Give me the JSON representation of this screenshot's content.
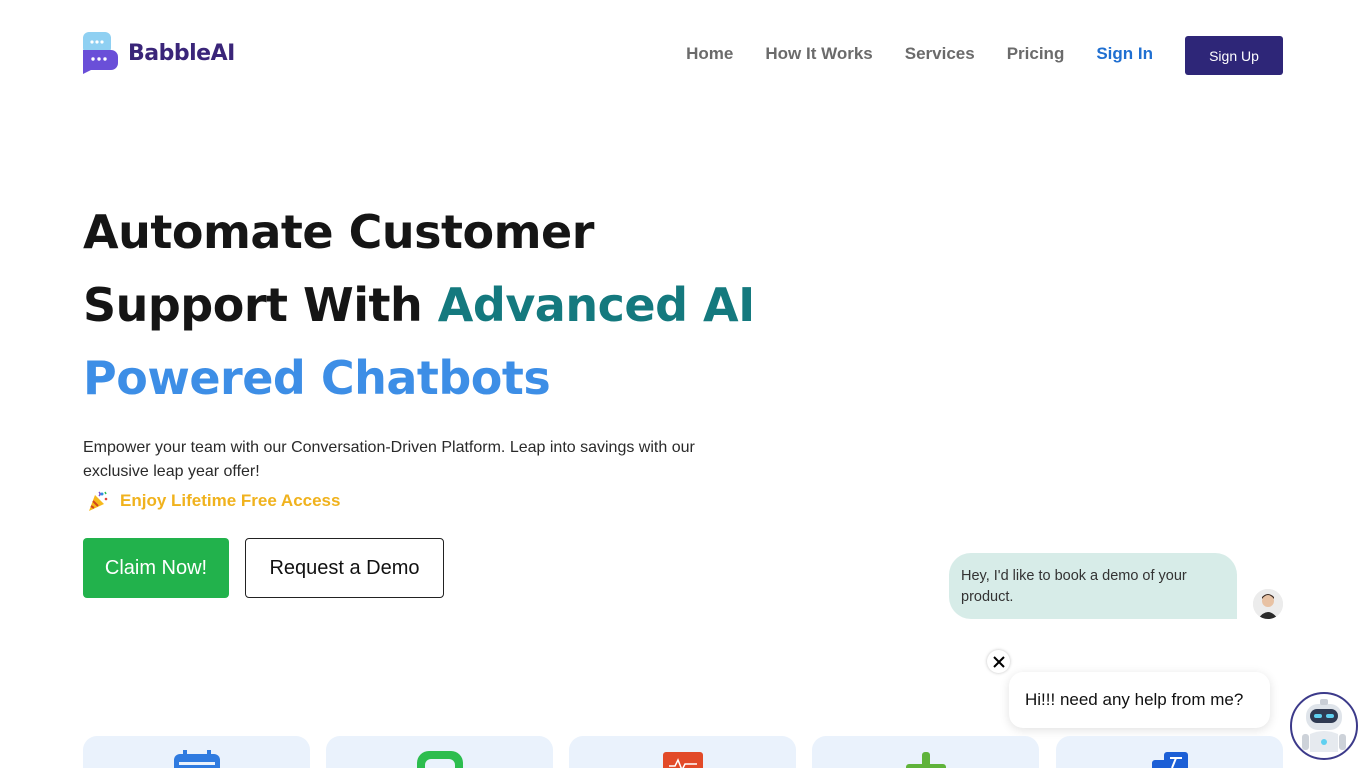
{
  "brand": {
    "name": "BabbleAI",
    "icon": "chat-bubbles-logo"
  },
  "nav": {
    "items": [
      "Home",
      "How It Works",
      "Services",
      "Pricing"
    ],
    "signin_label": "Sign In",
    "signup_label": "Sign Up"
  },
  "hero": {
    "title_line1": "Automate Customer",
    "title_line2_a": "Support With ",
    "title_line2_b": "Advanced AI",
    "title_line3": "Powered Chatbots",
    "subtitle": "Empower your team with our Conversation-Driven Platform. Leap into savings with our exclusive leap year offer!",
    "offer_text": "Enjoy Lifetime Free Access",
    "offer_icon": "party-popper-icon",
    "claim_label": "Claim Now!",
    "demo_label": "Request a Demo"
  },
  "chat": {
    "user_message": "Hey, I'd like to book a demo of your product.",
    "widget_greeting": "Hi!!! need any help from me?"
  },
  "cards": [
    {
      "icon": "calendar-icon",
      "color": "#2f7be0"
    },
    {
      "icon": "chat-icon",
      "color": "#2dbd4e"
    },
    {
      "icon": "analytics-icon",
      "color": "#e24a28"
    },
    {
      "icon": "puzzle-icon",
      "color": "#5fb33a"
    },
    {
      "icon": "translate-icon",
      "color": "#1c5fd6"
    }
  ],
  "colors": {
    "brand_dark": "#2e2678",
    "teal": "#14797e",
    "blue": "#3d8ee6",
    "offer": "#f0b21d",
    "cta_green": "#22b24c"
  }
}
